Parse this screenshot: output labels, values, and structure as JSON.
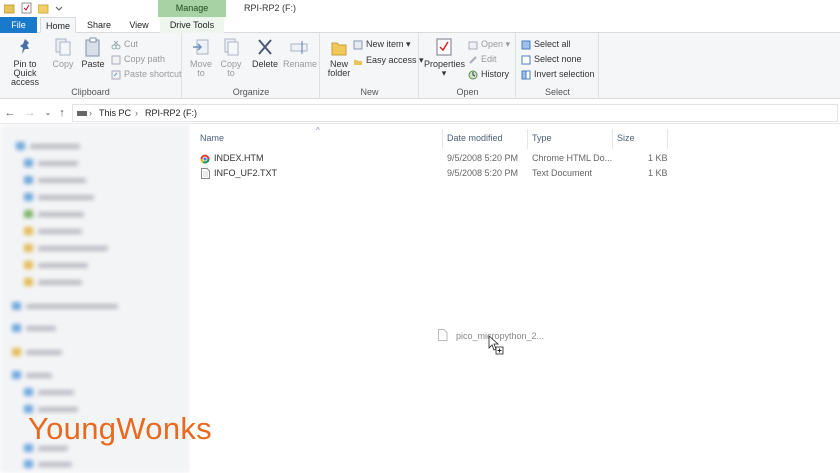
{
  "titlebar": {
    "manage_label": "Manage",
    "window_title": "RPI-RP2 (F:)"
  },
  "tabs": {
    "file": "File",
    "home": "Home",
    "share": "Share",
    "view": "View",
    "drive_tools": "Drive Tools"
  },
  "ribbon": {
    "clipboard": {
      "pin_line1": "Pin to Quick",
      "pin_line2": "access",
      "copy": "Copy",
      "paste": "Paste",
      "cut": "Cut",
      "copy_path": "Copy path",
      "paste_shortcut": "Paste shortcut",
      "label": "Clipboard"
    },
    "organize": {
      "move_line1": "Move",
      "move_line2": "to",
      "copy_line1": "Copy",
      "copy_line2": "to",
      "delete": "Delete",
      "rename": "Rename",
      "label": "Organize"
    },
    "new": {
      "folder_line1": "New",
      "folder_line2": "folder",
      "new_item": "New item",
      "easy_access": "Easy access",
      "label": "New"
    },
    "open": {
      "properties": "Properties",
      "open": "Open",
      "edit": "Edit",
      "history": "History",
      "label": "Open"
    },
    "select": {
      "select_all": "Select all",
      "select_none": "Select none",
      "invert": "Invert selection",
      "label": "Select"
    }
  },
  "address": {
    "crumbs": [
      "This PC",
      "RPI-RP2 (F:)"
    ]
  },
  "columns": {
    "name": "Name",
    "date": "Date modified",
    "type": "Type",
    "size": "Size"
  },
  "files": [
    {
      "name": "INDEX.HTM",
      "date": "9/5/2008 5:20 PM",
      "type": "Chrome HTML Do...",
      "size": "1 KB",
      "icon": "chrome-icon"
    },
    {
      "name": "INFO_UF2.TXT",
      "date": "9/5/2008 5:20 PM",
      "type": "Text Document",
      "size": "1 KB",
      "icon": "text-file-icon"
    }
  ],
  "drag": {
    "label": "pico_micropython_2..."
  },
  "brand": {
    "text": "YoungWonks",
    "color": "#e86a1f"
  },
  "colors": {
    "file_tab": "#1979ca",
    "manage_tab": "#a7d3a4",
    "ribbon_bg": "#f5f6f7"
  }
}
